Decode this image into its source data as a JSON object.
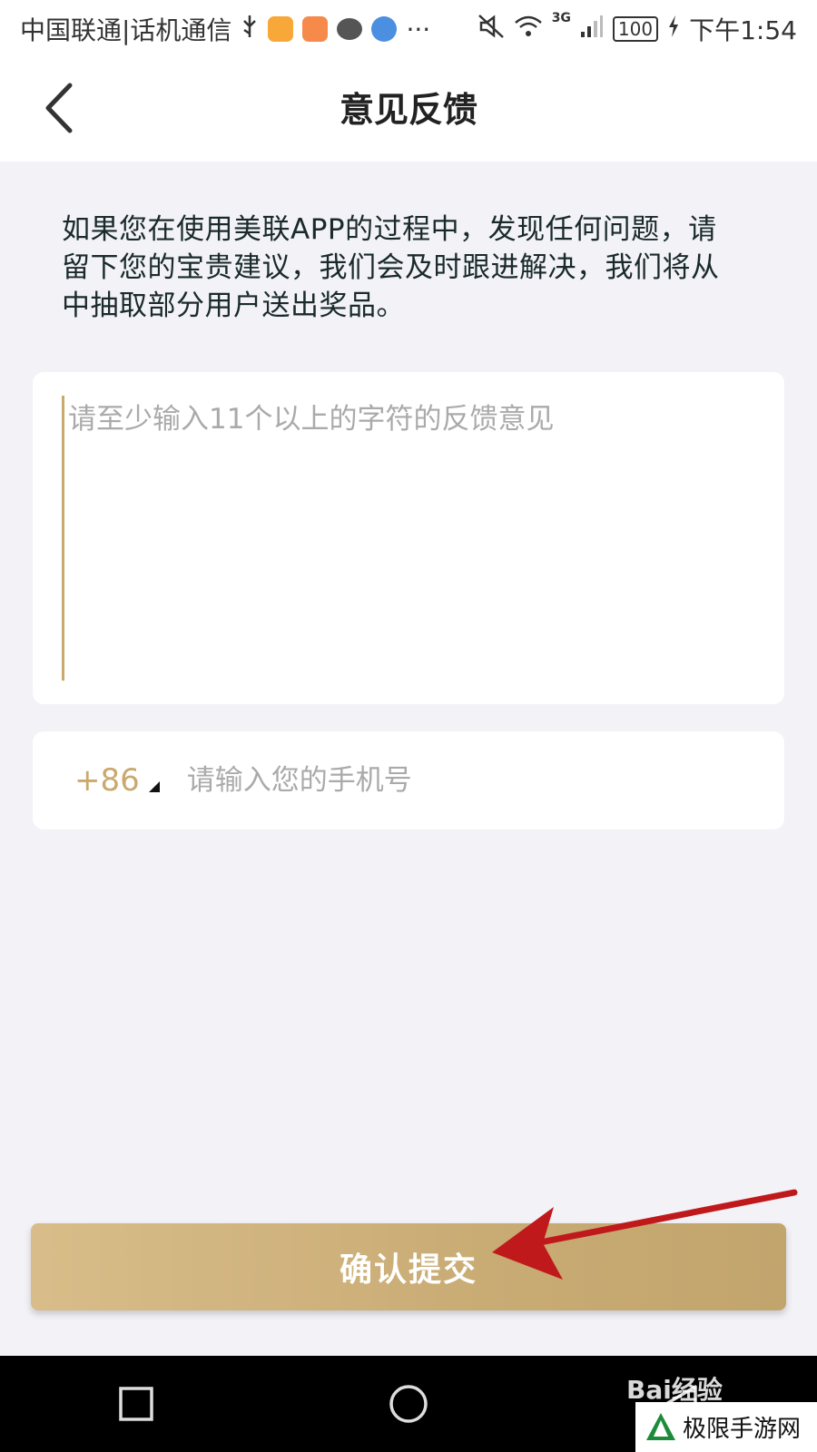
{
  "status_bar": {
    "carrier": "中国联通|话机通信",
    "more": "···",
    "network": "3G",
    "battery": "100",
    "time": "下午1:54"
  },
  "nav": {
    "title": "意见反馈"
  },
  "intro": {
    "text": "如果您在使用美联APP的过程中，发现任何问题，请留下您的宝贵建议，我们会及时跟进解决，我们将从中抽取部分用户送出奖品。"
  },
  "feedback": {
    "placeholder": "请至少输入11个以上的字符的反馈意见",
    "value": ""
  },
  "phone": {
    "country_code": "+86",
    "placeholder": "请输入您的手机号",
    "value": ""
  },
  "submit": {
    "label": "确认提交"
  },
  "watermark": {
    "baidu": "Bai经验",
    "site": "极限手游网"
  },
  "colors": {
    "accent_gold": "#c9a96e",
    "arrow_red": "#c0191b"
  }
}
